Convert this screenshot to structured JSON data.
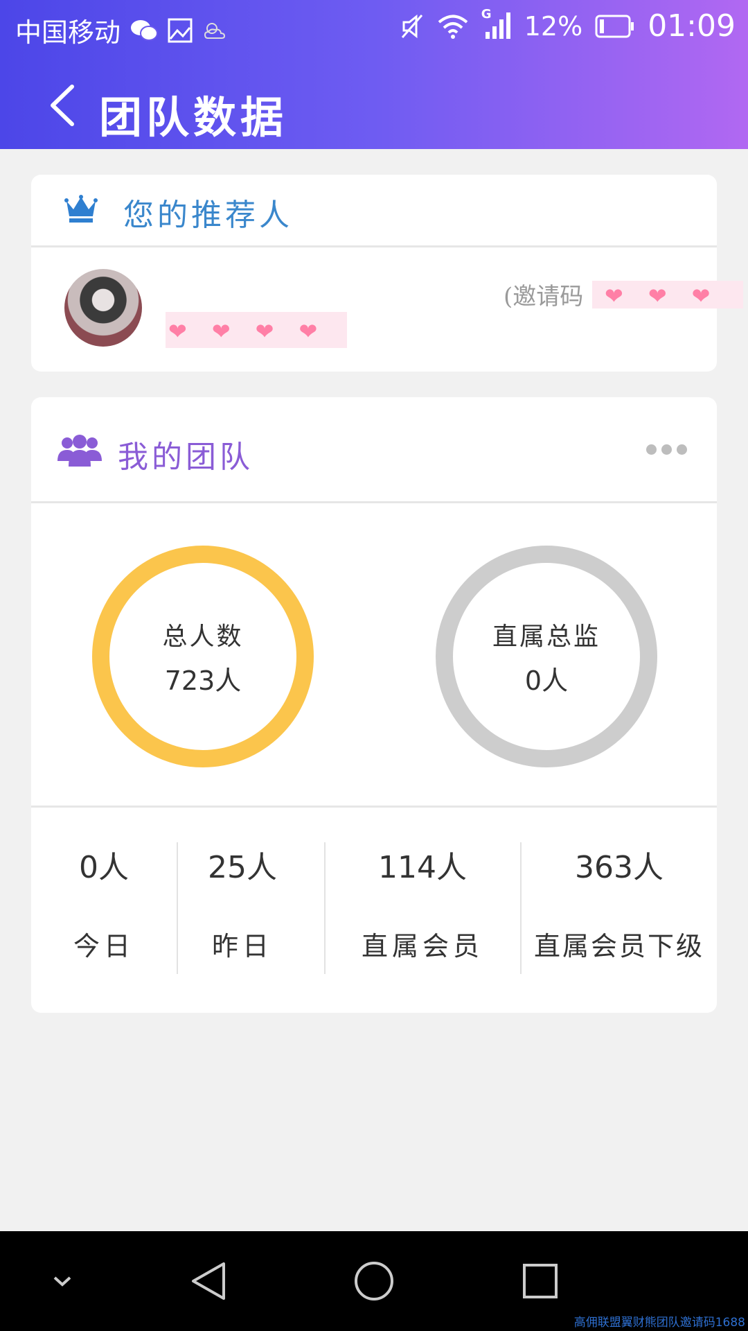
{
  "status_bar": {
    "carrier": "中国移动",
    "network_badge": "G",
    "battery": "12%",
    "time": "01:09"
  },
  "nav": {
    "title": "团队数据"
  },
  "referrer_card": {
    "title": "您的推荐人",
    "name_masked": "❤❤❤❤",
    "invite_label": "(邀请码",
    "invite_masked": "❤❤❤"
  },
  "team_card": {
    "title": "我的团队",
    "total_label": "总人数",
    "total_value": "723人",
    "direct_director_label": "直属总监",
    "direct_director_value": "0人",
    "stats": [
      {
        "value": "0人",
        "label": "今日"
      },
      {
        "value": "25人",
        "label": "昨日"
      },
      {
        "value": "114人",
        "label": "直属会员"
      },
      {
        "value": "363人",
        "label": "直属会员下级"
      }
    ]
  },
  "watermark": "高佣联盟翼财熊团队邀请码1688",
  "colors": {
    "header_gradient_start": "#4c46e8",
    "header_gradient_end": "#b168f2",
    "total_ring": "#fbc54c",
    "director_ring": "#cdcdcd",
    "referrer_title": "#3a87cc",
    "team_title": "#8a5cd6"
  }
}
